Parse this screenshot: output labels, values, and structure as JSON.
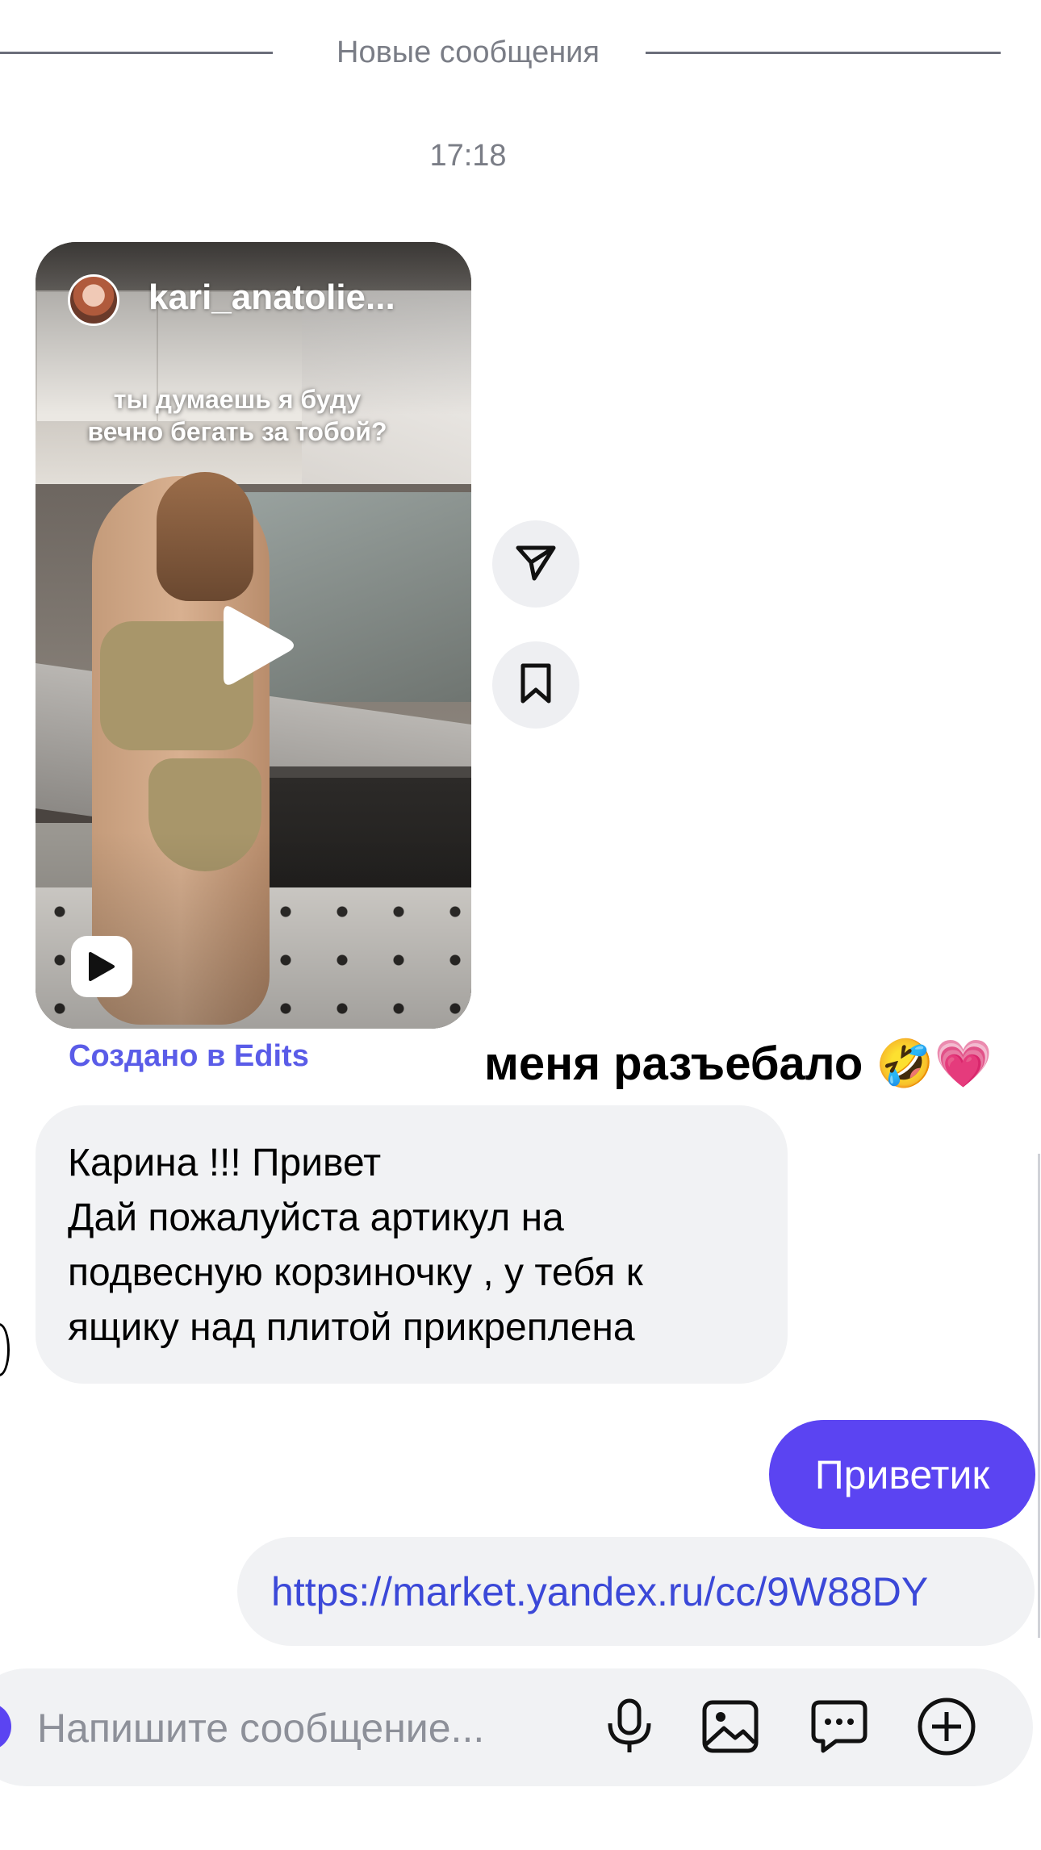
{
  "divider": {
    "label": "Новые сообщения"
  },
  "timestamp": "17:18",
  "shared_reel": {
    "username": "kari_anatolie...",
    "caption_line1": "ты думаешь я буду",
    "caption_line2": "вечно бегать за тобой?",
    "play_icon": "play-icon",
    "reels_icon": "reels-icon",
    "footer": "Создано в Edits"
  },
  "side_actions": [
    {
      "icon": "send-icon"
    },
    {
      "icon": "bookmark-icon"
    }
  ],
  "reaction_message": "меня разъебало 🤣💗",
  "incoming_message": {
    "lines": [
      "Карина !!! Привет",
      "Дай пожалуйста артикул на",
      "подвесную корзиночку , у тебя к",
      "ящику над плитой прикреплена"
    ]
  },
  "outgoing_messages": [
    {
      "text": "Приветик"
    },
    {
      "text": "https://market.yandex.ru/cc/9W88DY"
    }
  ],
  "composer": {
    "placeholder": "Напишите сообщение...",
    "icons": [
      "microphone-icon",
      "image-icon",
      "sticker-icon",
      "plus-icon"
    ]
  },
  "colors": {
    "accent": "#5b44f2",
    "link": "#3b48d8",
    "edits": "#5a5ce8",
    "bubble_gray": "#f1f2f4",
    "meta_gray": "#7a7d86"
  }
}
